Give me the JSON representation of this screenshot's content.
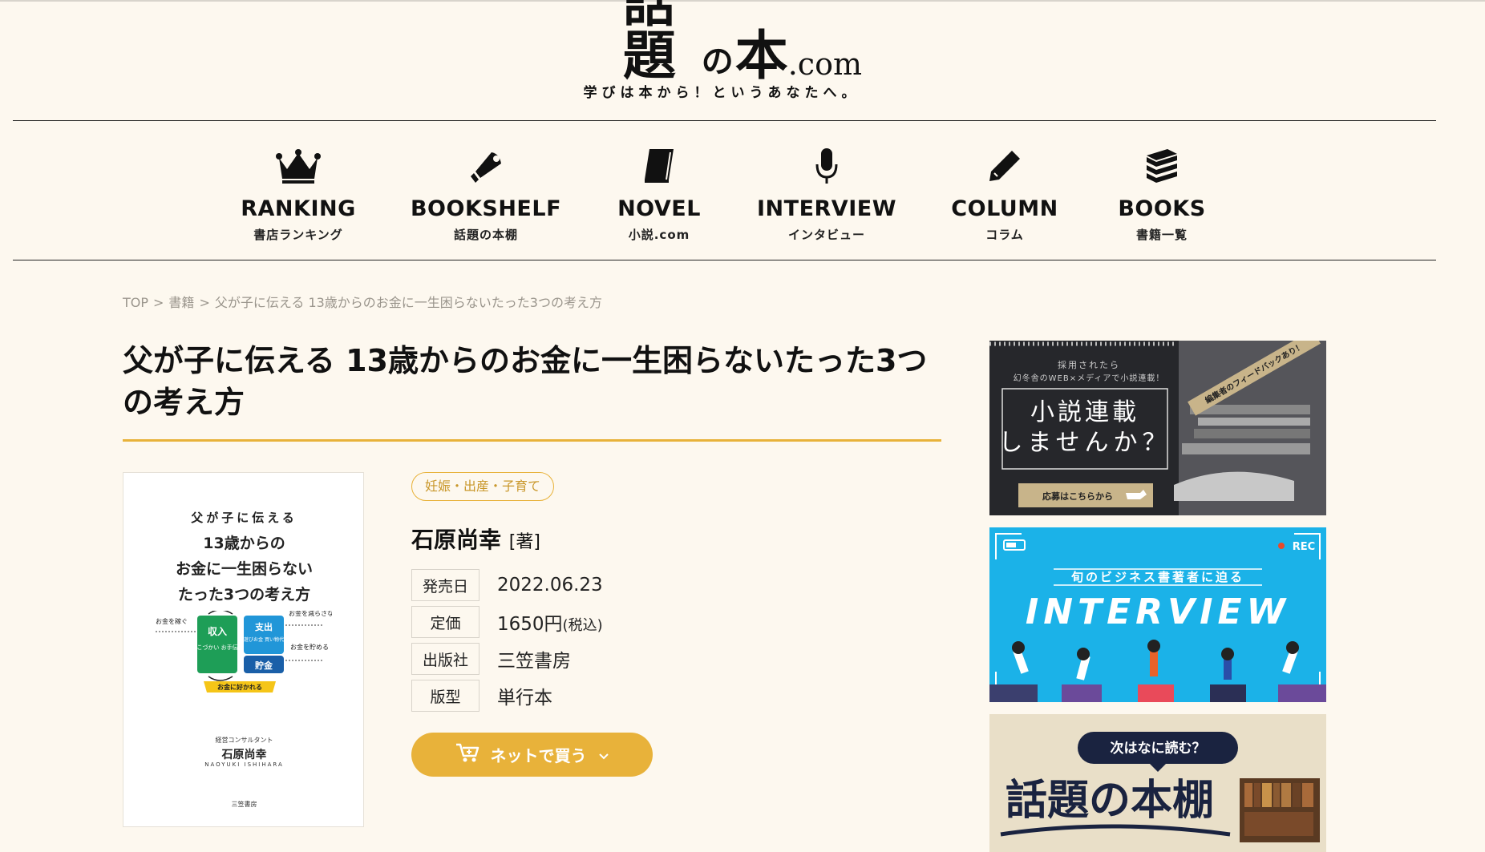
{
  "site": {
    "logo_main": "話題",
    "logo_no": "の",
    "logo_main2": "本",
    "logo_com": ".com",
    "tagline": "学びは本から！というあなたへ。"
  },
  "nav": [
    {
      "en": "RANKING",
      "jp": "書店ランキング",
      "icon": "crown-icon"
    },
    {
      "en": "BOOKSHELF",
      "jp": "話題の本棚",
      "icon": "megaphone-icon"
    },
    {
      "en": "NOVEL",
      "jp": "小説.com",
      "icon": "book-icon"
    },
    {
      "en": "INTERVIEW",
      "jp": "インタビュー",
      "icon": "microphone-icon"
    },
    {
      "en": "COLUMN",
      "jp": "コラム",
      "icon": "pencil-icon"
    },
    {
      "en": "BOOKS",
      "jp": "書籍一覧",
      "icon": "books-stack-icon"
    }
  ],
  "breadcrumb": {
    "items": [
      "TOP",
      "書籍",
      "父が子に伝える 13歳からのお金に一生困らないたった3つの考え方"
    ],
    "separator": ">"
  },
  "book": {
    "title": "父が子に伝える 13歳からのお金に一生困らないたった3つの考え方",
    "category": "妊娠・出産・子育て",
    "author": "石原尚幸",
    "author_role": "[著]",
    "info": [
      {
        "label": "発売日",
        "value": "2022.06.23",
        "suffix": ""
      },
      {
        "label": "定価",
        "value": "1650円",
        "suffix": "(税込)"
      },
      {
        "label": "出版社",
        "value": "三笠書房",
        "suffix": ""
      },
      {
        "label": "版型",
        "value": "単行本",
        "suffix": ""
      }
    ],
    "buy_label": "ネットで買う",
    "cover": {
      "line1": "父が子に伝える",
      "line2": "13歳からの",
      "line3": "お金に一生困らない",
      "line4": "たった3つの考え方",
      "box_income": "収入",
      "box_income_sub": "おこづかい お手伝い",
      "box_expense": "支出",
      "box_expense_sub": "遊びお金 買い物代",
      "box_saving": "貯金",
      "label1": "お金を稼ぐ",
      "label2": "お金を減らさない",
      "label3": "お金を貯める",
      "bottom_badge": "お金に好かれる",
      "author_role": "経営コンサルタント",
      "author": "石原尚幸",
      "author_en": "NAOYUKI ISHIHARA",
      "publisher": "三笠書房"
    }
  },
  "banners": {
    "novel": {
      "top_text": "採用されたら",
      "sub_text": "幻冬舎のWEB×メディアで小説連載！",
      "ribbon": "編集者のフィードバックあり！",
      "main1": "小説連載",
      "main2": "しませんか？",
      "button": "応募はこちらから"
    },
    "interview": {
      "rec": "REC",
      "sub": "旬のビジネス書著者に迫る",
      "main": "INTERVIEW"
    },
    "bookshelf": {
      "bubble": "次はなに読む？",
      "main": "話題の本棚"
    }
  },
  "colors": {
    "background": "#fdf8ef",
    "accent": "#e8b23a",
    "interview_bg": "#1bb2e8"
  }
}
